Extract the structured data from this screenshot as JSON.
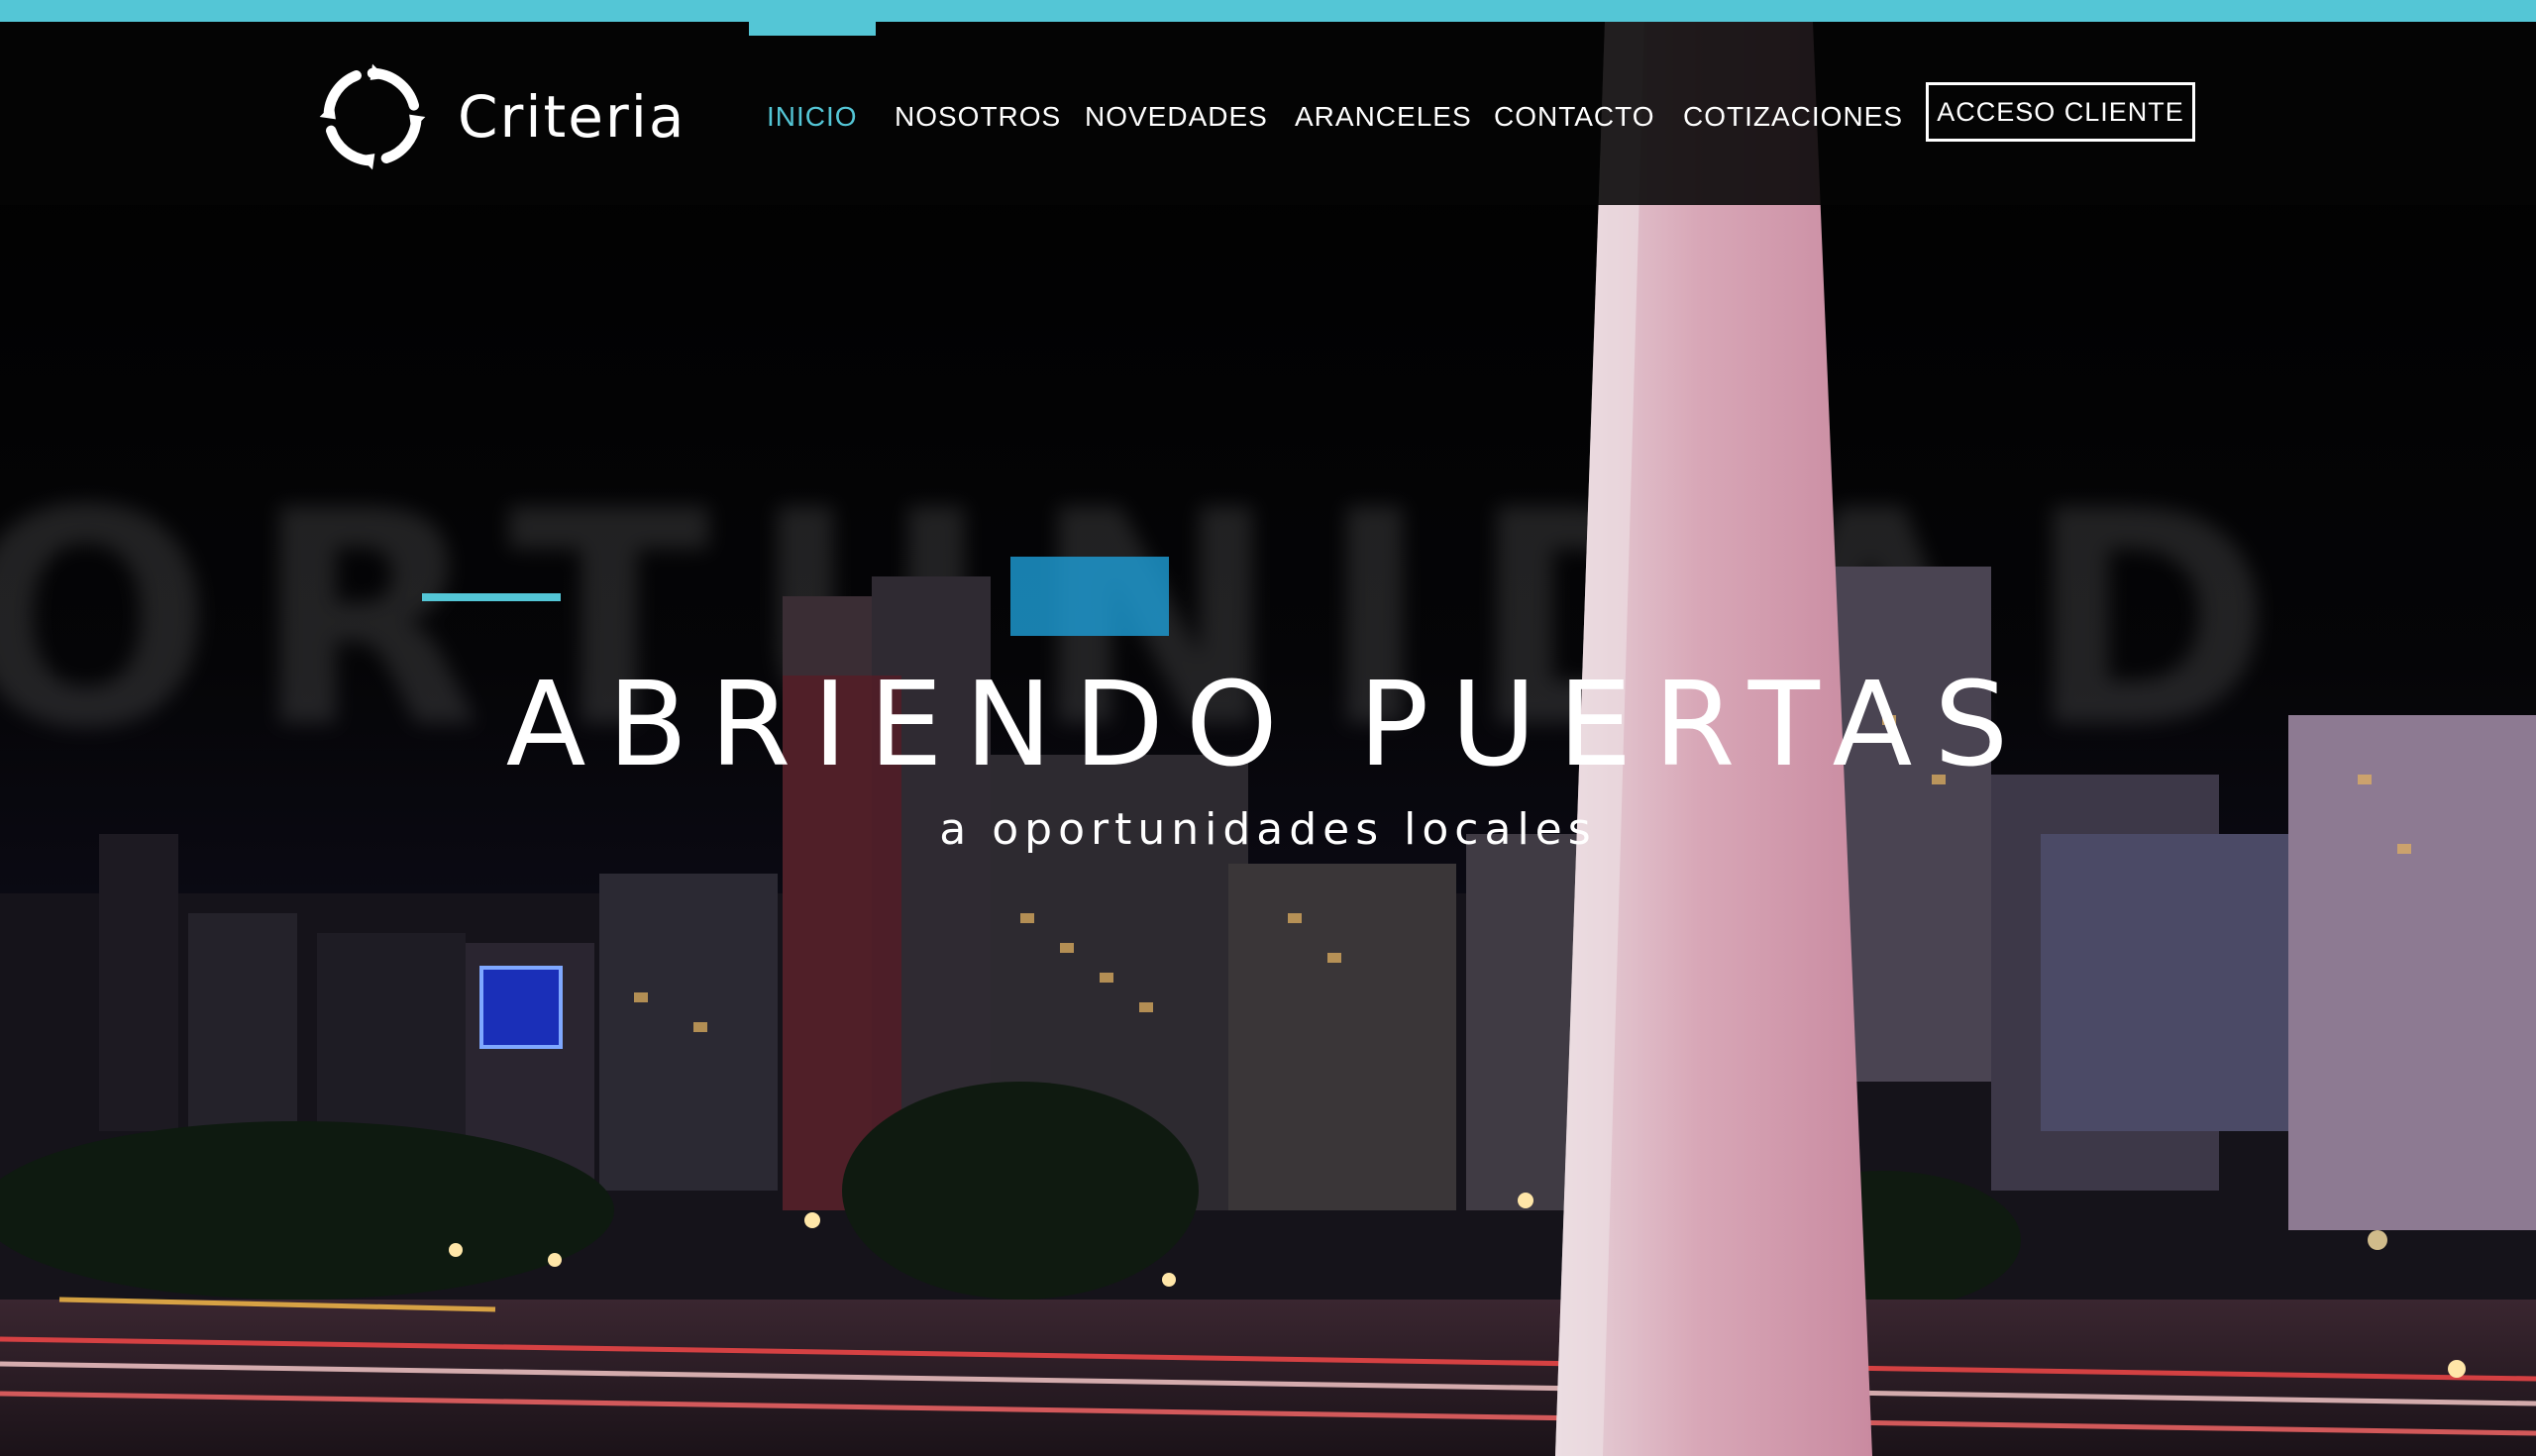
{
  "brand": {
    "name": "Criteria",
    "icon": "criteria-logo-icon"
  },
  "nav": {
    "items": [
      {
        "label": "INICIO",
        "active": true
      },
      {
        "label": "NOSOTROS",
        "active": false
      },
      {
        "label": "NOVEDADES",
        "active": false
      },
      {
        "label": "ARANCELES",
        "active": false
      },
      {
        "label": "CONTACTO",
        "active": false
      },
      {
        "label": "COTIZACIONES",
        "active": false
      }
    ],
    "cta_label": "ACCESO CLIENTE"
  },
  "hero": {
    "title": "ABRIENDO PUERTAS",
    "subtitle": "a oportunidades locales",
    "background_word": "ORTUNIDAD",
    "background": "night city skyline with obelisk"
  },
  "colors": {
    "accent": "#54c6d6",
    "background": "#050505",
    "text": "#ffffff"
  }
}
